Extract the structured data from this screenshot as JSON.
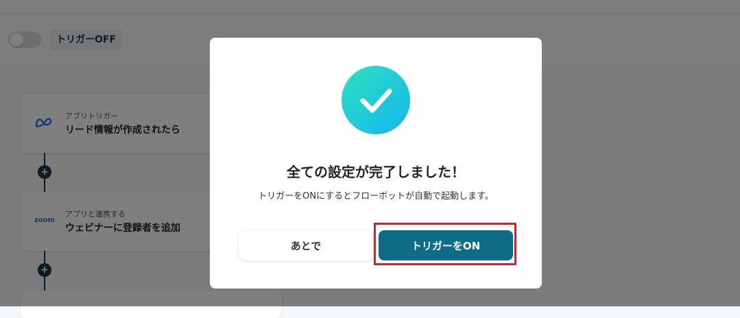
{
  "toolbar": {
    "trigger_status": "トリガーOFF"
  },
  "flow": {
    "steps": [
      {
        "subtitle": "アプリトリガー",
        "title": "リード情報が作成されたら",
        "icon": "meta-icon"
      },
      {
        "subtitle": "アプリと連携する",
        "title": "ウェビナーに登録者を追加",
        "icon": "zoom-logo",
        "logo_text": "zoom"
      }
    ],
    "add_symbol": "+"
  },
  "modal": {
    "title": "全ての設定が完了しました！",
    "description": "トリガーをONにするとフローボットが自動で起動します。",
    "later_label": "あとで",
    "on_label": "トリガーをON",
    "icon": "check-circle-icon"
  },
  "colors": {
    "primary": "#0f6c86",
    "highlight": "#d0232a",
    "check_gradient_start": "#2ee0c0",
    "check_gradient_end": "#14b6ef"
  }
}
